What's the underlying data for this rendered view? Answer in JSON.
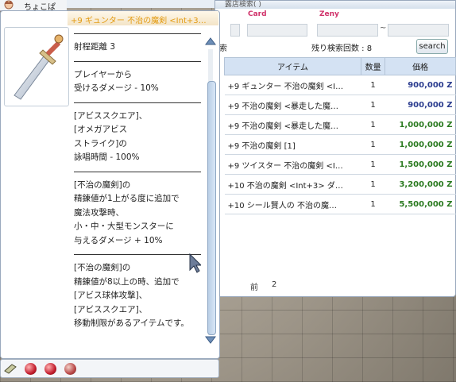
{
  "player": {
    "name": "ちょこぱ"
  },
  "shop": {
    "title": "露店検索( )",
    "labels": {
      "card": "Card",
      "zeny": "Zeny"
    },
    "tilde": "~",
    "partial": "索",
    "remaining": "残り検索回数 : 8",
    "search_label": "search",
    "columns": [
      "アイテム",
      "数量",
      "価格"
    ],
    "rows": [
      {
        "name": "+9 ギュンター 不治の魔剣 <I…",
        "qty": "1",
        "price": "900,000 Z",
        "color": "#2b3c8f"
      },
      {
        "name": "+9 不治の魔剣 <暴走した魔…",
        "qty": "1",
        "price": "900,000 Z",
        "color": "#2b3c8f"
      },
      {
        "name": "+9 不治の魔剣 <暴走した魔…",
        "qty": "1",
        "price": "1,000,000 Z",
        "color": "#2a7a1f"
      },
      {
        "name": "+9 不治の魔剣 [1]",
        "qty": "1",
        "price": "1,000,000 Z",
        "color": "#2a7a1f"
      },
      {
        "name": "+9 ツイスター 不治の魔剣 <I…",
        "qty": "1",
        "price": "1,500,000 Z",
        "color": "#2a7a1f"
      },
      {
        "name": "+10 不治の魔剣 <Int+3> ダ…",
        "qty": "1",
        "price": "3,200,000 Z",
        "color": "#2a7a1f"
      },
      {
        "name": "+10 シール賢人の 不治の魔…",
        "qty": "1",
        "price": "5,500,000 Z",
        "color": "#2a7a1f"
      }
    ],
    "pagination": {
      "prev": "前",
      "page": "2"
    }
  },
  "item": {
    "title": "+9 ギュンター 不治の魔剣 <Int+3…",
    "lines": [
      {
        "sep": true
      },
      {
        "text": "射程距離 3"
      },
      {
        "sep": true
      },
      {
        "text": "プレイヤーから"
      },
      {
        "text": "受けるダメージ - 10%"
      },
      {
        "sep": true
      },
      {
        "text": "[アビススクエア]、"
      },
      {
        "text": "[オメガアビス"
      },
      {
        "text": "ストライク]の"
      },
      {
        "text": "詠唱時間 - 100%"
      },
      {
        "sep": true
      },
      {
        "text": "[不治の魔剣]の"
      },
      {
        "text": "精錬値が1上がる度に追加で"
      },
      {
        "text": "魔法攻撃時、"
      },
      {
        "text": "小・中・大型モンスターに"
      },
      {
        "text": "与えるダメージ + 10%"
      },
      {
        "sep": true
      },
      {
        "text": "[不治の魔剣]の"
      },
      {
        "text": "精錬値が8以上の時、追加で"
      },
      {
        "text": "[アビス球体攻撃]、"
      },
      {
        "text": "[アビススクエア]、"
      },
      {
        "text": "移動制限があるアイテムです。"
      }
    ]
  },
  "colors": {
    "item_title": "#e39b12",
    "card_zeny_label": "#d0326a",
    "price_blue": "#2b3c8f",
    "price_green": "#2a7a1f"
  },
  "icons": [
    "sword-icon",
    "scroll-up-icon",
    "scroll-down-icon",
    "mouse-cursor-icon",
    "orb-icon",
    "book-icon"
  ]
}
